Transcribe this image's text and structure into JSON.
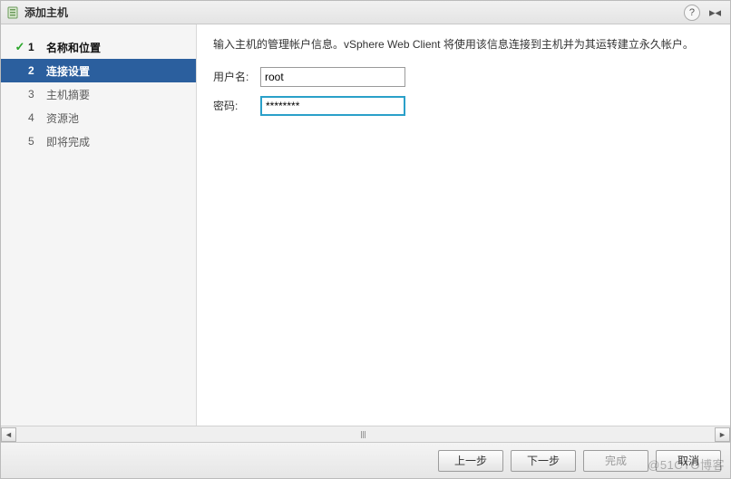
{
  "dialog": {
    "title": "添加主机",
    "help_tooltip": "?"
  },
  "steps": [
    {
      "num": "1",
      "label": "名称和位置",
      "state": "completed"
    },
    {
      "num": "2",
      "label": "连接设置",
      "state": "active"
    },
    {
      "num": "3",
      "label": "主机摘要",
      "state": "pending"
    },
    {
      "num": "4",
      "label": "资源池",
      "state": "pending"
    },
    {
      "num": "5",
      "label": "即将完成",
      "state": "pending"
    }
  ],
  "main": {
    "instruction": "输入主机的管理帐户信息。vSphere Web Client 将使用该信息连接到主机并为其运转建立永久帐户。",
    "username_label": "用户名:",
    "username_value": "root",
    "password_label": "密码:",
    "password_value": "********"
  },
  "footer": {
    "back": "上一步",
    "next": "下一步",
    "finish": "完成",
    "cancel": "取消"
  },
  "watermark": "@51CTO博客"
}
